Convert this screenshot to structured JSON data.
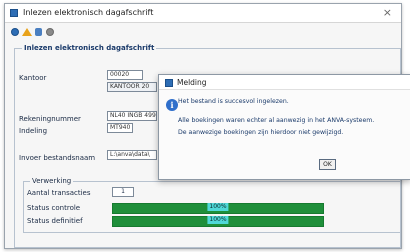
{
  "window": {
    "title": "Inlezen elektronisch dagafschrift",
    "close_glyph": "×"
  },
  "toolbar": {
    "icons": [
      "help-icon",
      "home-icon",
      "filter-icon",
      "record-icon"
    ]
  },
  "form": {
    "group_title": "Inlezen elektronisch dagafschrift",
    "kantoor_label": "Kantoor",
    "kantoor_code": "00020",
    "kantoor_name": "KANTOOR 20",
    "rekeningnummer_label": "Rekeningnummer",
    "rekeningnummer_value": "NL40 INGB 499",
    "indeling_label": "Indeling",
    "indeling_value": "MT940",
    "invoer_label": "Invoer bestandsnaam",
    "invoer_value": "L:\\anva\\data\\"
  },
  "verwerking": {
    "title": "Verwerking",
    "aantal_label": "Aantal transacties",
    "aantal_value": "1",
    "status_controle_label": "Status controle",
    "status_controle_pct": "100%",
    "status_definitief_label": "Status definitief",
    "status_definitief_pct": "100%"
  },
  "dialog": {
    "title": "Melding",
    "line1": "Het bestand is succesvol ingelezen.",
    "line2": "Alle boekingen waren echter al aanwezig in het ANVA-systeem.",
    "line3": "De aanwezige boekingen zijn hierdoor niet gewijzigd.",
    "ok_label": "OK"
  },
  "colors": {
    "progress": "#1f8f3a",
    "progress_label": "#4fd8d8",
    "accent": "#2d6db5"
  }
}
